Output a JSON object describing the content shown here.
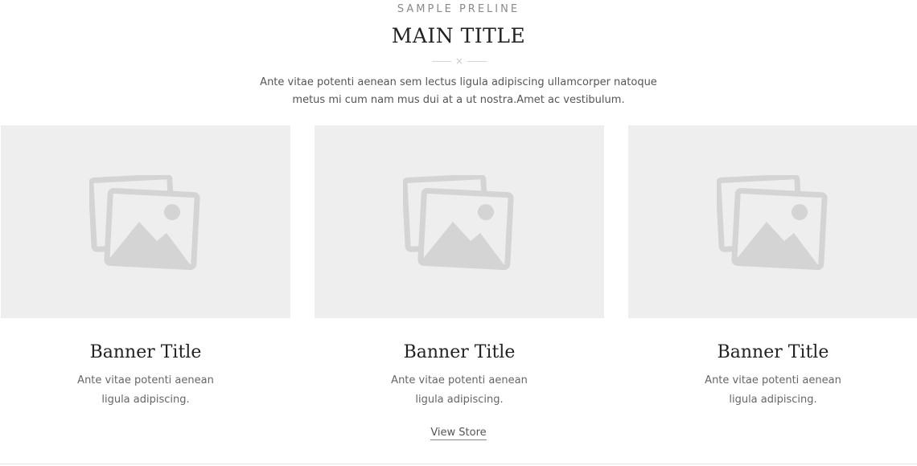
{
  "header": {
    "preline": "SAMPLE PRELINE",
    "title": "MAIN TITLE",
    "divider_icon": "×",
    "intro_line1": "Ante vitae potenti aenean sem lectus ligula adipiscing ullamcorper natoque",
    "intro_line2": "metus mi cum nam mus dui at a ut nostra.Amet ac vestibulum."
  },
  "banners": [
    {
      "image_icon": "image-placeholder-icon",
      "title": "Banner Title",
      "desc_line1": "Ante vitae potenti aenean",
      "desc_line2": "ligula adipiscing."
    },
    {
      "image_icon": "image-placeholder-icon",
      "title": "Banner Title",
      "desc_line1": "Ante vitae potenti aenean",
      "desc_line2": "ligula adipiscing."
    },
    {
      "image_icon": "image-placeholder-icon",
      "title": "Banner Title",
      "desc_line1": "Ante vitae potenti aenean",
      "desc_line2": "ligula adipiscing."
    }
  ],
  "cta": {
    "view_store_label": "View Store"
  },
  "colors": {
    "placeholder_bg": "#eeeeee",
    "placeholder_icon": "#d4d4d4",
    "title_text": "#222222",
    "body_text": "#555555"
  }
}
